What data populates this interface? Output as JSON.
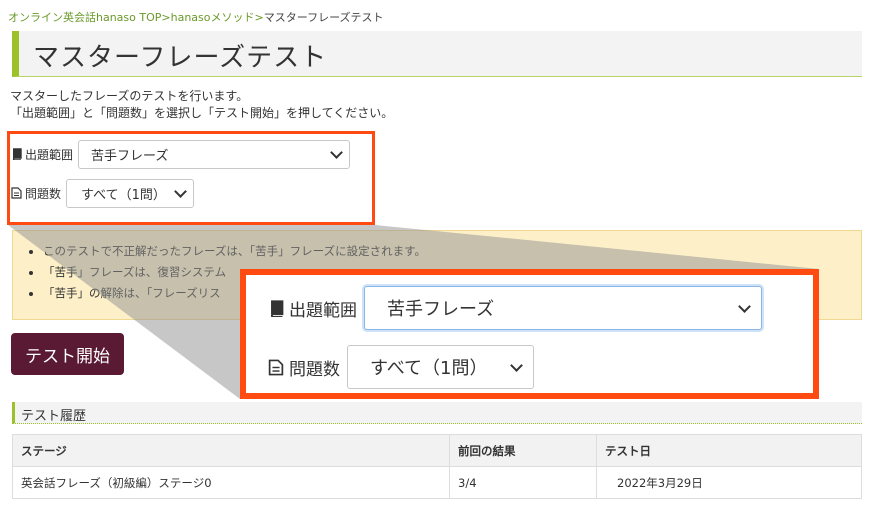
{
  "breadcrumb": {
    "home": "オンライン英会話hanaso TOP",
    "sep1": ">",
    "method": "hanasoメソッド",
    "sep2": ">",
    "current": "マスターフレーズテスト"
  },
  "page": {
    "title": "マスターフレーズテスト",
    "intro_line1": "マスターしたフレーズのテストを行います。",
    "intro_line2": "「出題範囲」と「問題数」を選択し「テスト開始」を押してください。"
  },
  "form": {
    "range_label": "出題範囲",
    "range_value": "苦手フレーズ",
    "count_label": "問題数",
    "count_value": "すべて（1問）"
  },
  "notice": {
    "items": [
      "このテストで不正解だったフレーズは、「苦手」フレーズに設定されます。",
      "「苦手」フレーズは、復習システム",
      "「苦手」の解除は、「フレーズリス"
    ]
  },
  "start_button": "テスト開始",
  "history": {
    "title": "テスト履歴",
    "headers": [
      "ステージ",
      "前回の結果",
      "テスト日"
    ],
    "rows": [
      [
        "英会話フレーズ（初級編）ステージ0",
        "3/4",
        "2022年3月29日"
      ]
    ]
  },
  "colors": {
    "accent_green": "#9cc12b",
    "highlight_orange": "#ff4a12",
    "button_maroon": "#5b1a33",
    "notice_bg": "#fdf0c9"
  },
  "icons": {
    "range": "book-icon",
    "count": "document-icon"
  }
}
